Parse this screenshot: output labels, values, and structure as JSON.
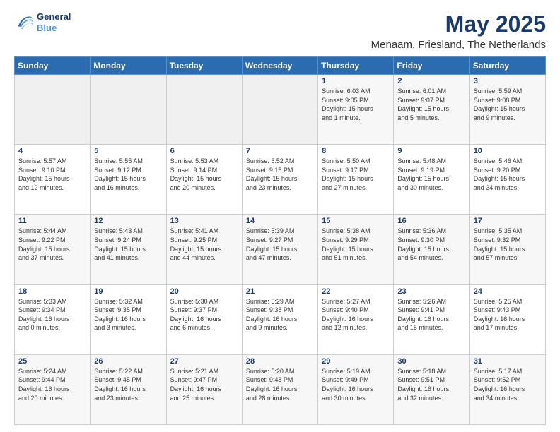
{
  "header": {
    "logo_line1": "General",
    "logo_line2": "Blue",
    "title": "May 2025",
    "subtitle": "Menaam, Friesland, The Netherlands"
  },
  "weekdays": [
    "Sunday",
    "Monday",
    "Tuesday",
    "Wednesday",
    "Thursday",
    "Friday",
    "Saturday"
  ],
  "weeks": [
    [
      {
        "day": "",
        "info": ""
      },
      {
        "day": "",
        "info": ""
      },
      {
        "day": "",
        "info": ""
      },
      {
        "day": "",
        "info": ""
      },
      {
        "day": "1",
        "info": "Sunrise: 6:03 AM\nSunset: 9:05 PM\nDaylight: 15 hours\nand 1 minute."
      },
      {
        "day": "2",
        "info": "Sunrise: 6:01 AM\nSunset: 9:07 PM\nDaylight: 15 hours\nand 5 minutes."
      },
      {
        "day": "3",
        "info": "Sunrise: 5:59 AM\nSunset: 9:08 PM\nDaylight: 15 hours\nand 9 minutes."
      }
    ],
    [
      {
        "day": "4",
        "info": "Sunrise: 5:57 AM\nSunset: 9:10 PM\nDaylight: 15 hours\nand 12 minutes."
      },
      {
        "day": "5",
        "info": "Sunrise: 5:55 AM\nSunset: 9:12 PM\nDaylight: 15 hours\nand 16 minutes."
      },
      {
        "day": "6",
        "info": "Sunrise: 5:53 AM\nSunset: 9:14 PM\nDaylight: 15 hours\nand 20 minutes."
      },
      {
        "day": "7",
        "info": "Sunrise: 5:52 AM\nSunset: 9:15 PM\nDaylight: 15 hours\nand 23 minutes."
      },
      {
        "day": "8",
        "info": "Sunrise: 5:50 AM\nSunset: 9:17 PM\nDaylight: 15 hours\nand 27 minutes."
      },
      {
        "day": "9",
        "info": "Sunrise: 5:48 AM\nSunset: 9:19 PM\nDaylight: 15 hours\nand 30 minutes."
      },
      {
        "day": "10",
        "info": "Sunrise: 5:46 AM\nSunset: 9:20 PM\nDaylight: 15 hours\nand 34 minutes."
      }
    ],
    [
      {
        "day": "11",
        "info": "Sunrise: 5:44 AM\nSunset: 9:22 PM\nDaylight: 15 hours\nand 37 minutes."
      },
      {
        "day": "12",
        "info": "Sunrise: 5:43 AM\nSunset: 9:24 PM\nDaylight: 15 hours\nand 41 minutes."
      },
      {
        "day": "13",
        "info": "Sunrise: 5:41 AM\nSunset: 9:25 PM\nDaylight: 15 hours\nand 44 minutes."
      },
      {
        "day": "14",
        "info": "Sunrise: 5:39 AM\nSunset: 9:27 PM\nDaylight: 15 hours\nand 47 minutes."
      },
      {
        "day": "15",
        "info": "Sunrise: 5:38 AM\nSunset: 9:29 PM\nDaylight: 15 hours\nand 51 minutes."
      },
      {
        "day": "16",
        "info": "Sunrise: 5:36 AM\nSunset: 9:30 PM\nDaylight: 15 hours\nand 54 minutes."
      },
      {
        "day": "17",
        "info": "Sunrise: 5:35 AM\nSunset: 9:32 PM\nDaylight: 15 hours\nand 57 minutes."
      }
    ],
    [
      {
        "day": "18",
        "info": "Sunrise: 5:33 AM\nSunset: 9:34 PM\nDaylight: 16 hours\nand 0 minutes."
      },
      {
        "day": "19",
        "info": "Sunrise: 5:32 AM\nSunset: 9:35 PM\nDaylight: 16 hours\nand 3 minutes."
      },
      {
        "day": "20",
        "info": "Sunrise: 5:30 AM\nSunset: 9:37 PM\nDaylight: 16 hours\nand 6 minutes."
      },
      {
        "day": "21",
        "info": "Sunrise: 5:29 AM\nSunset: 9:38 PM\nDaylight: 16 hours\nand 9 minutes."
      },
      {
        "day": "22",
        "info": "Sunrise: 5:27 AM\nSunset: 9:40 PM\nDaylight: 16 hours\nand 12 minutes."
      },
      {
        "day": "23",
        "info": "Sunrise: 5:26 AM\nSunset: 9:41 PM\nDaylight: 16 hours\nand 15 minutes."
      },
      {
        "day": "24",
        "info": "Sunrise: 5:25 AM\nSunset: 9:43 PM\nDaylight: 16 hours\nand 17 minutes."
      }
    ],
    [
      {
        "day": "25",
        "info": "Sunrise: 5:24 AM\nSunset: 9:44 PM\nDaylight: 16 hours\nand 20 minutes."
      },
      {
        "day": "26",
        "info": "Sunrise: 5:22 AM\nSunset: 9:45 PM\nDaylight: 16 hours\nand 23 minutes."
      },
      {
        "day": "27",
        "info": "Sunrise: 5:21 AM\nSunset: 9:47 PM\nDaylight: 16 hours\nand 25 minutes."
      },
      {
        "day": "28",
        "info": "Sunrise: 5:20 AM\nSunset: 9:48 PM\nDaylight: 16 hours\nand 28 minutes."
      },
      {
        "day": "29",
        "info": "Sunrise: 5:19 AM\nSunset: 9:49 PM\nDaylight: 16 hours\nand 30 minutes."
      },
      {
        "day": "30",
        "info": "Sunrise: 5:18 AM\nSunset: 9:51 PM\nDaylight: 16 hours\nand 32 minutes."
      },
      {
        "day": "31",
        "info": "Sunrise: 5:17 AM\nSunset: 9:52 PM\nDaylight: 16 hours\nand 34 minutes."
      }
    ]
  ]
}
